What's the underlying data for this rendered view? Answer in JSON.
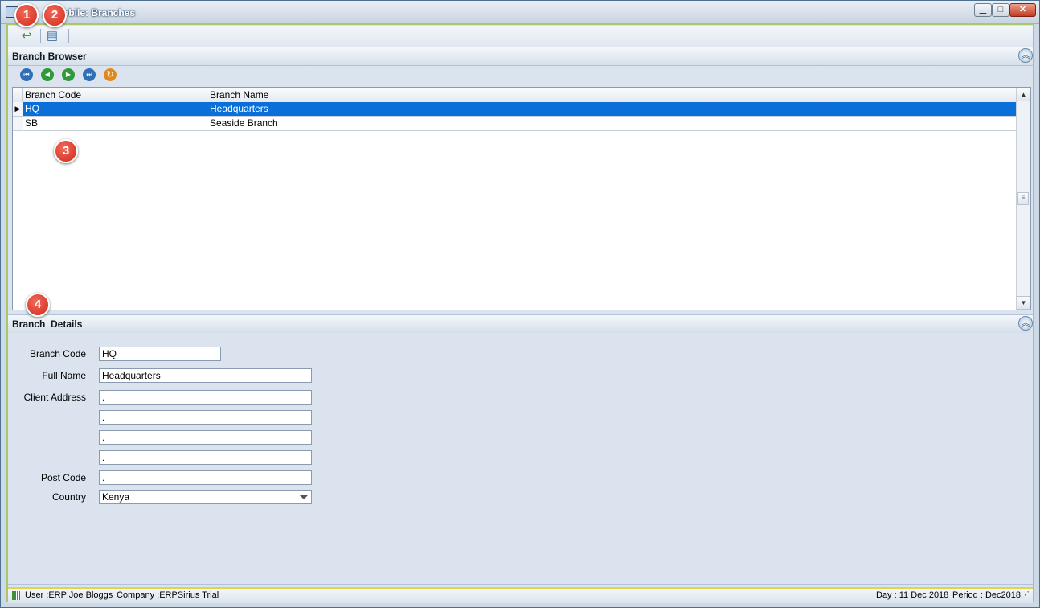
{
  "window": {
    "title": "+Mobile: Branches",
    "minimize_glyph": "▁",
    "maximize_glyph": "□",
    "close_glyph": "✕"
  },
  "toolbar": {
    "buttons": [
      {
        "name": "back",
        "icon": "undo-arrow-icon",
        "glyph": "↩"
      },
      {
        "name": "new",
        "icon": "new-document-icon",
        "glyph": "▤"
      }
    ]
  },
  "branch_browser": {
    "title": "Branch Browser",
    "nav": [
      {
        "name": "first",
        "glyph": "⏮",
        "color": "#2f6fb8"
      },
      {
        "name": "previous",
        "glyph": "◀",
        "color": "#2f9a3a"
      },
      {
        "name": "next",
        "glyph": "▶",
        "color": "#2f9a3a"
      },
      {
        "name": "last",
        "glyph": "⏭",
        "color": "#2f6fb8"
      },
      {
        "name": "refresh",
        "glyph": "↻",
        "color": "#e08a1e"
      }
    ],
    "columns": [
      "Branch Code",
      "Branch Name"
    ],
    "rows": [
      {
        "code": "HQ",
        "name": "Headquarters",
        "selected": true
      },
      {
        "code": "SB",
        "name": "Seaside Branch",
        "selected": false
      }
    ],
    "current_row_marker": "▶"
  },
  "branch_details": {
    "title": "Branch  Details",
    "labels": {
      "branch_code": "Branch Code",
      "full_name": "Full Name",
      "client_address": "Client Address",
      "post_code": "Post Code",
      "country": "Country"
    },
    "values": {
      "branch_code": "HQ",
      "full_name": "Headquarters",
      "address_1": ".",
      "address_2": ".",
      "address_3": ".",
      "address_4": ".",
      "post_code": ".",
      "country": "Kenya"
    }
  },
  "status": {
    "user": "User :ERP Joe Bloggs",
    "company": "Company :ERPSirius Trial",
    "day": "Day : 11 Dec 2018",
    "period": "Period : Dec2018"
  },
  "annotations": [
    "1",
    "2",
    "3",
    "4"
  ],
  "colors": {
    "selection": "#0a6fd8",
    "badge": "#d2291a",
    "frame_accent": "#a8c86a"
  }
}
